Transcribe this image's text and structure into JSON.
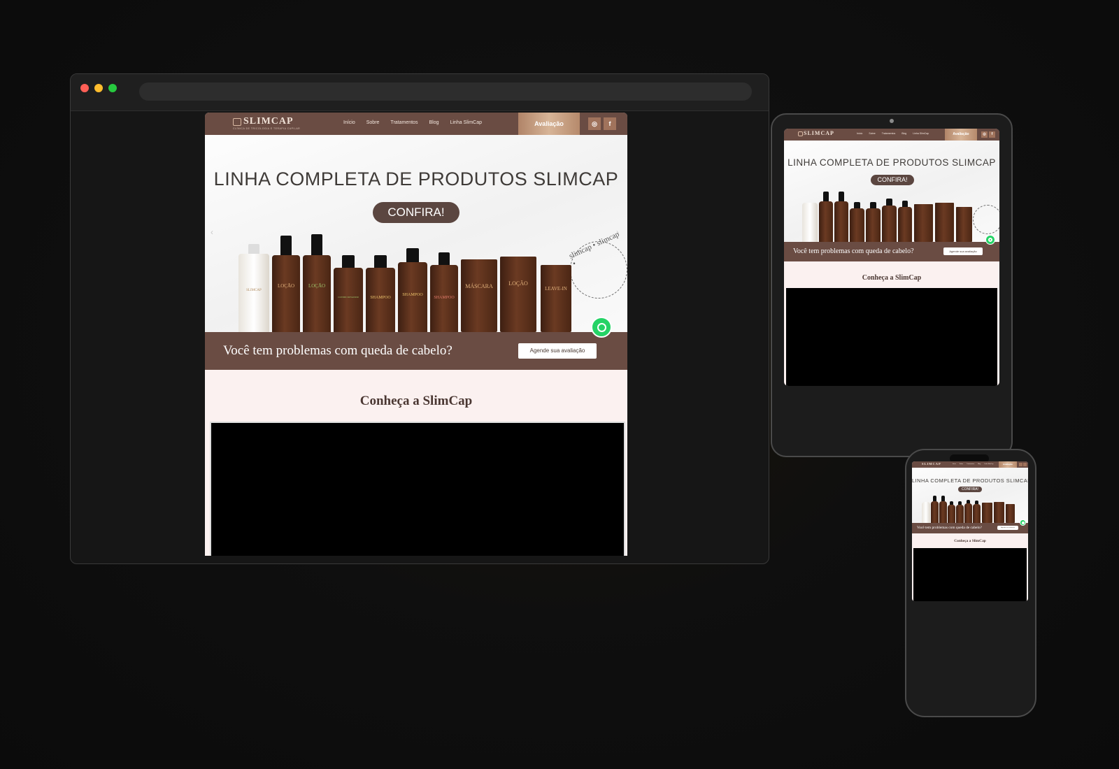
{
  "browser": {
    "dot_colors": [
      "#ff5f56",
      "#ffbd2e",
      "#27c93f"
    ]
  },
  "site": {
    "logo": {
      "text": "SLIMCAP",
      "subtitle": "CLÍNICA DE TRICOLOGIA E TERAPIA CAPILAR"
    },
    "nav": [
      "Início",
      "Sobre",
      "Tratamentos",
      "Blog",
      "Linha SlimCap"
    ],
    "cta": "Avaliação",
    "social": [
      "instagram-icon",
      "facebook-icon"
    ],
    "hero": {
      "title": "LINHA COMPLETA DE PRODUTOS SLIMCAP",
      "button": "CONFIRA!",
      "ring_text": "slimcap • slimcap •",
      "products": [
        "SLIMCAP",
        "LOÇÃO",
        "LOÇÃO",
        "CONDICIONADOR",
        "SHAMPOO",
        "SHAMPOO",
        "SHAMPOO",
        "MÁSCARA",
        "LOÇÃO",
        "LEAVE-IN"
      ]
    },
    "band": {
      "text": "Você tem problemas com queda de cabelo?",
      "button": "Agende sua avaliação"
    },
    "section_title": "Conheça a SlimCap"
  },
  "colors": {
    "brown": "#6a4c43",
    "cream": "#fbf1f0",
    "whatsapp": "#25d366"
  }
}
